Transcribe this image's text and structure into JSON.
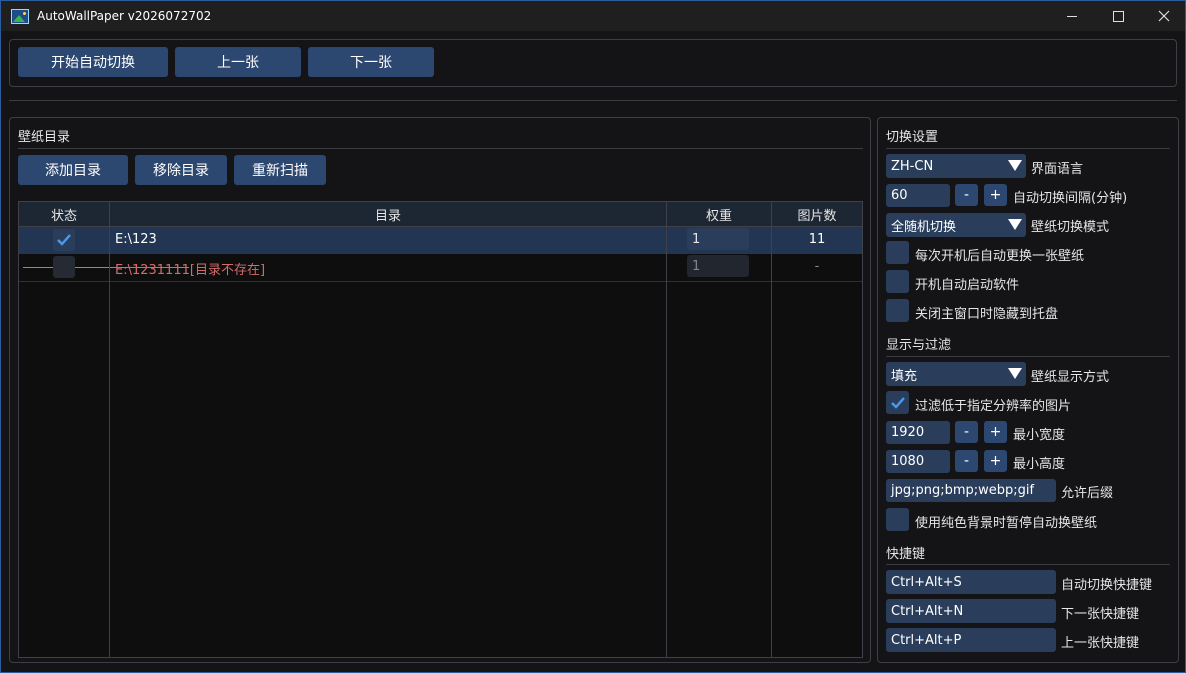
{
  "window": {
    "title": "AutoWallPaper v2026072702"
  },
  "toolbar": {
    "start_label": "开始自动切换",
    "prev_label": "上一张",
    "next_label": "下一张"
  },
  "folders": {
    "title": "壁纸目录",
    "add_label": "添加目录",
    "remove_label": "移除目录",
    "rescan_label": "重新扫描",
    "columns": {
      "status": "状态",
      "directory": "目录",
      "weight": "权重",
      "count": "图片数"
    },
    "rows": [
      {
        "checked": true,
        "path": "E:\\123",
        "weight": "1",
        "count": "11",
        "missing": false
      },
      {
        "checked": false,
        "path": "E:\\1231111[目录不存在]",
        "weight": "1",
        "count": "-",
        "missing": true
      }
    ]
  },
  "switch_settings": {
    "title": "切换设置",
    "language": {
      "value": "ZH-CN",
      "label": "界面语言"
    },
    "interval": {
      "value": "60",
      "minus": "-",
      "plus": "+",
      "label": "自动切换间隔(分钟)"
    },
    "mode": {
      "value": "全随机切换",
      "label": "壁纸切换模式"
    },
    "change_on_boot": {
      "checked": false,
      "label": "每次开机后自动更换一张壁纸"
    },
    "autostart": {
      "checked": false,
      "label": "开机自动启动软件"
    },
    "hide_to_tray": {
      "checked": false,
      "label": "关闭主窗口时隐藏到托盘"
    }
  },
  "display_filter": {
    "title": "显示与过滤",
    "fit": {
      "value": "填充",
      "label": "壁纸显示方式"
    },
    "filter_low_res": {
      "checked": true,
      "label": "过滤低于指定分辨率的图片"
    },
    "min_width": {
      "value": "1920",
      "minus": "-",
      "plus": "+",
      "label": "最小宽度"
    },
    "min_height": {
      "value": "1080",
      "minus": "-",
      "plus": "+",
      "label": "最小高度"
    },
    "extensions": {
      "value": "jpg;png;bmp;webp;gif",
      "label": "允许后缀"
    },
    "pause_solid": {
      "checked": false,
      "label": "使用纯色背景时暂停自动换壁纸"
    }
  },
  "hotkeys": {
    "title": "快捷键",
    "auto": {
      "value": "Ctrl+Alt+S",
      "label": "自动切换快捷键"
    },
    "next": {
      "value": "Ctrl+Alt+N",
      "label": "下一张快捷键"
    },
    "prev": {
      "value": "Ctrl+Alt+P",
      "label": "上一张快捷键"
    }
  },
  "colors": {
    "accent": "#2c4770",
    "field": "#2a3e5c",
    "selected_row": "#223552",
    "error_text": "#d36b6b",
    "window_border": "#2a5d9f"
  }
}
